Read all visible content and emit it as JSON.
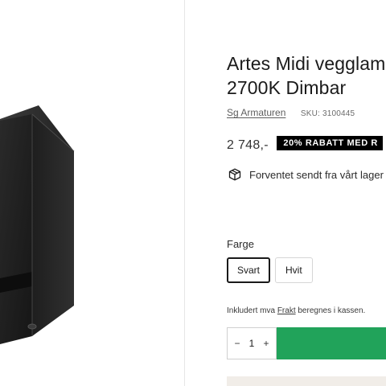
{
  "product": {
    "title_line1": "Artes Midi vegglam",
    "title_line2": "2700K Dimbar",
    "vendor": "Sg Armaturen",
    "sku": "SKU: 3100445"
  },
  "pricing": {
    "price": "2 748,-",
    "badge": "20% RABATT MED R"
  },
  "shipping": {
    "text": "Forventet sendt fra vårt lager",
    "icon": "box-icon"
  },
  "variant": {
    "label": "Farge",
    "options": [
      "Svart",
      "Hvit"
    ],
    "selected": "Svart"
  },
  "tax": {
    "prefix": "Inkludert mva ",
    "link": "Frakt",
    "suffix": " beregnes i kassen."
  },
  "quantity": {
    "minus": "−",
    "value": "1",
    "plus": "+"
  },
  "colors": {
    "accent_green": "#21a35a",
    "badge_bg": "#000000",
    "lamp": "#1c1c1c"
  }
}
